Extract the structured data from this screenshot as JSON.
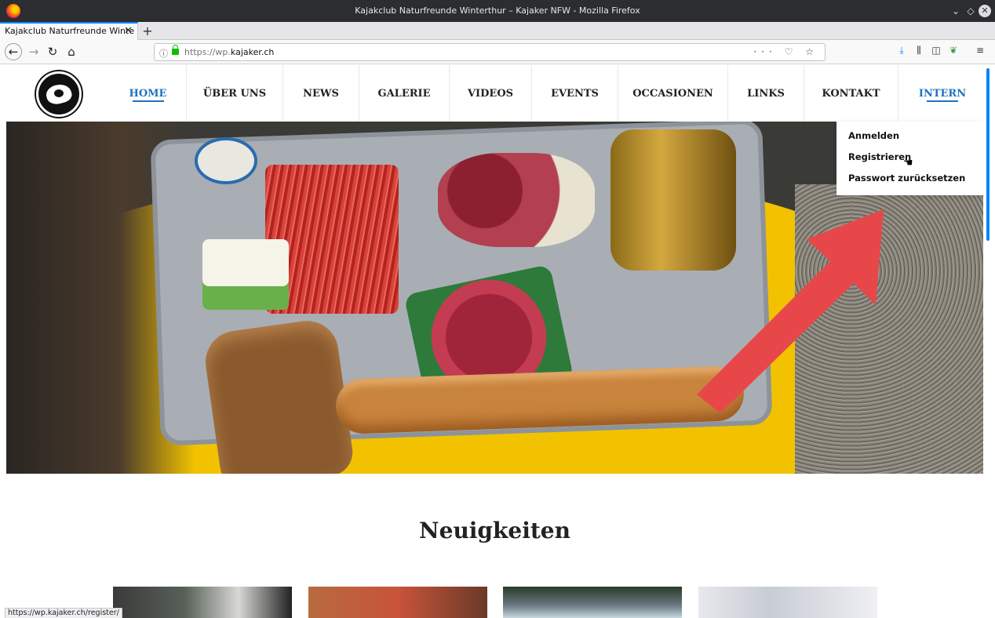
{
  "window": {
    "title": "Kajakclub Naturfreunde Winterthur – Kajaker NFW - Mozilla Firefox",
    "controls": [
      "minimize",
      "maximize",
      "close"
    ]
  },
  "tabs": [
    {
      "label": "Kajakclub Naturfreunde Winte",
      "close": "✕"
    }
  ],
  "new_tab_label": "+",
  "nav": {
    "url_prefix": "https://wp.",
    "url_domain": "kajaker.ch",
    "more_label": "···"
  },
  "site": {
    "menu": [
      {
        "label": "HOME",
        "active": true
      },
      {
        "label": "ÜBER UNS",
        "active": false
      },
      {
        "label": "NEWS",
        "active": false
      },
      {
        "label": "GALERIE",
        "active": false
      },
      {
        "label": "VIDEOS",
        "active": false
      },
      {
        "label": "EVENTS",
        "active": false
      },
      {
        "label": "OCCASIONEN",
        "active": false
      },
      {
        "label": "LINKS",
        "active": false
      },
      {
        "label": "KONTAKT",
        "active": false
      },
      {
        "label": "INTERN",
        "active": true
      }
    ],
    "dropdown": [
      "Anmelden",
      "Registrieren",
      "Passwort zurücksetzen"
    ],
    "section_title": "Neuigkeiten",
    "accent_color": "#1e73be",
    "arrow_color": "#e8474a"
  },
  "status_url": "https://wp.kajaker.ch/register/"
}
